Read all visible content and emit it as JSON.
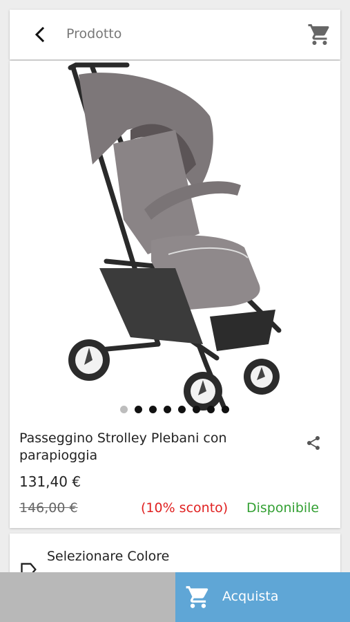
{
  "header": {
    "title": "Prodotto",
    "back_icon": "back-arrow-icon",
    "cart_icon": "shopping-cart-icon"
  },
  "product": {
    "name": "Passeggino Strolley Plebani con parapioggia",
    "price": "131,40 €",
    "old_price": "146,00 €",
    "discount": "(10% sconto)",
    "availability": "Disponibile",
    "share_icon": "share-icon",
    "gallery": {
      "current_index": 1,
      "total_images": 8
    }
  },
  "options": {
    "color_label": "Selezionare Colore",
    "tag_icon": "tag-icon"
  },
  "actions": {
    "buy_label": "Acquista",
    "buy_icon": "cart-icon"
  },
  "colors": {
    "accent": "#5fa6d6",
    "discount": "#e02020",
    "available": "#33a033"
  }
}
